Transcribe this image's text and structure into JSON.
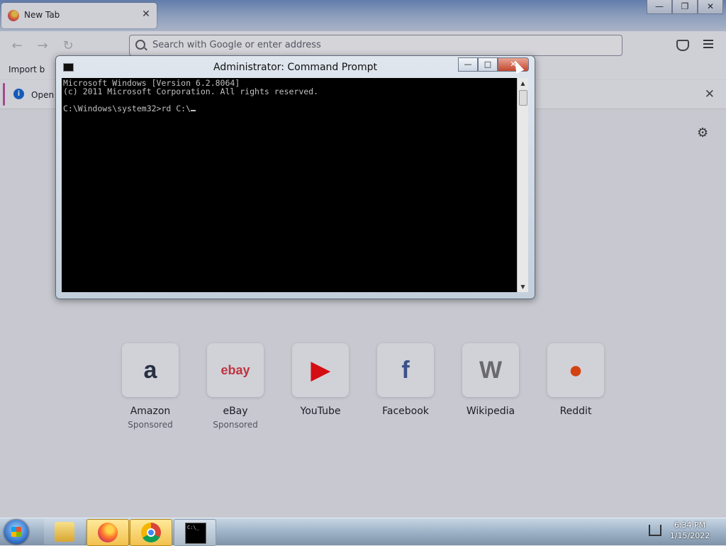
{
  "browser": {
    "tab": {
      "title": "New Tab",
      "close": "✕"
    },
    "window_controls": {
      "minimize": "—",
      "restore": "❐",
      "close": "✕"
    },
    "nav": {
      "back": "←",
      "forward": "→",
      "reload": "↻"
    },
    "urlbar": {
      "placeholder": "Search with Google or enter address"
    },
    "bookmarks": {
      "import_label": "Import b"
    },
    "notice": {
      "text": "Open",
      "close": "✕"
    },
    "settings_icon": "⚙",
    "shortcuts": [
      {
        "name": "Amazon",
        "sponsored": "Sponsored",
        "icon": "a",
        "color": "#232f3e"
      },
      {
        "name": "eBay",
        "sponsored": "Sponsored",
        "icon": "ebay",
        "color": "#e53238"
      },
      {
        "name": "YouTube",
        "sponsored": "",
        "icon": "▶",
        "color": "#ff0000"
      },
      {
        "name": "Facebook",
        "sponsored": "",
        "icon": "f",
        "color": "#3b5998"
      },
      {
        "name": "Wikipedia",
        "sponsored": "",
        "icon": "W",
        "color": "#777777"
      },
      {
        "name": "Reddit",
        "sponsored": "",
        "icon": "●",
        "color": "#ff4500"
      }
    ]
  },
  "cmd": {
    "title": "Administrator: Command Prompt",
    "controls": {
      "minimize": "—",
      "maximize": "□",
      "close": "✕"
    },
    "lines": [
      "Microsoft Windows [Version 6.2.8064]",
      "(c) 2011 Microsoft Corporation. All rights reserved.",
      "",
      "C:\\Windows\\system32>rd C:\\"
    ],
    "scroll_up": "▲",
    "scroll_down": "▼"
  },
  "taskbar": {
    "clock_time": "6:34 PM",
    "clock_date": "1/15/2022"
  }
}
